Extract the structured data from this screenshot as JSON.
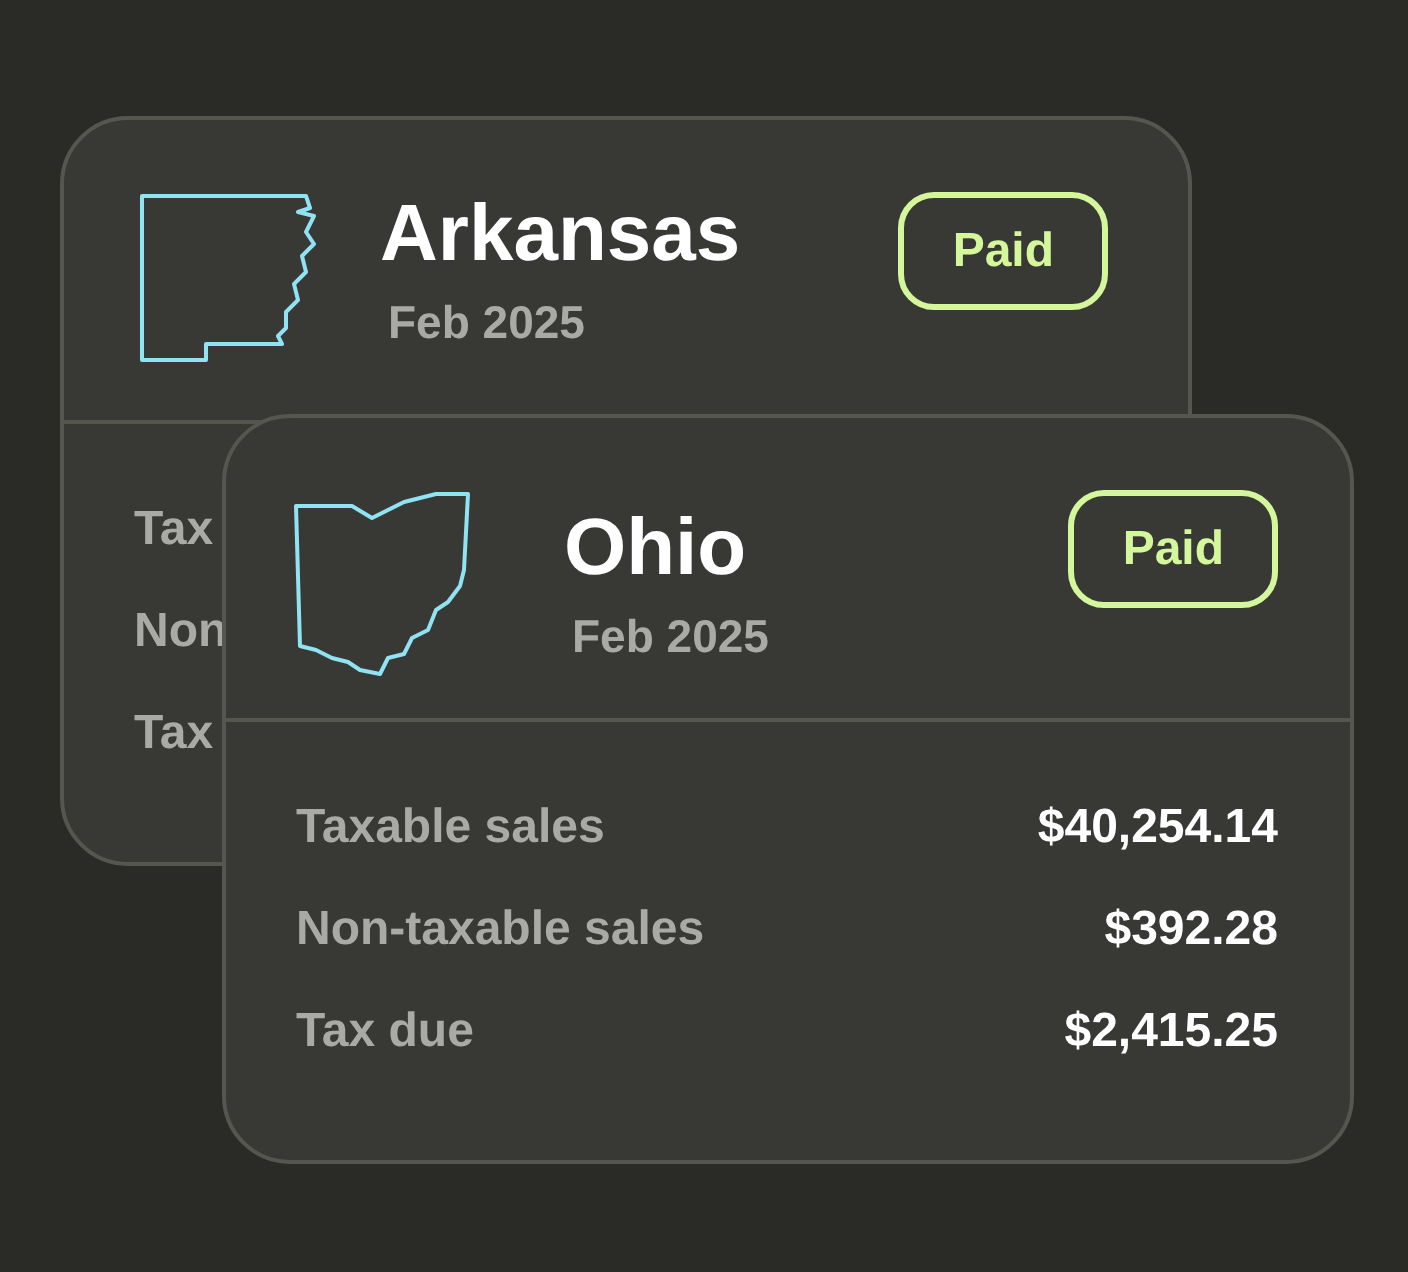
{
  "cards": [
    {
      "state": "Arkansas",
      "period": "Feb 2025",
      "status": {
        "label": "Paid",
        "kind": "paid"
      },
      "rows": [
        {
          "label": "Tax"
        },
        {
          "label": "Non"
        },
        {
          "label": "Tax"
        }
      ]
    },
    {
      "state": "Ohio",
      "period": "Feb 2025",
      "status": {
        "label": "Paid",
        "kind": "paid"
      },
      "rows": [
        {
          "label": "Taxable sales",
          "value": "$40,254.14"
        },
        {
          "label": "Non-taxable sales",
          "value": "$392.28"
        },
        {
          "label": "Tax due",
          "value": "$2,415.25"
        }
      ]
    }
  ]
}
